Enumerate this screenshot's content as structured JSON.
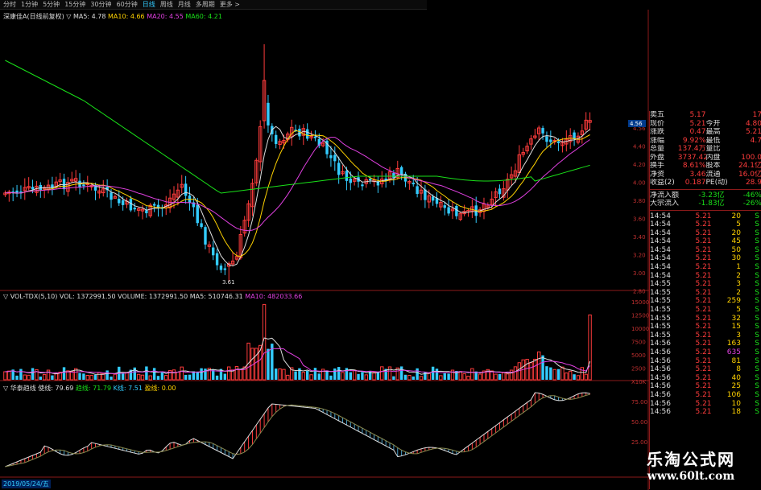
{
  "toolbar": {
    "items": [
      "分时",
      "1分钟",
      "5分钟",
      "15分钟",
      "30分钟",
      "60分钟",
      "日线",
      "周线",
      "月线",
      "多周期",
      "更多 >"
    ],
    "active_index": 6
  },
  "indicators": {
    "ma_line": {
      "name": "深康佳A(日线前复权)",
      "items": [
        {
          "label": "▽ MA5: 4.78",
          "color": "#dddddd"
        },
        {
          "label": "MA10: 4.66",
          "color": "#ffd200"
        },
        {
          "label": "MA20: 4.55",
          "color": "#e040e0"
        },
        {
          "label": "MA60: 4.21",
          "color": "#19e019"
        }
      ]
    },
    "vol_line": {
      "items": [
        {
          "label": "▽ VOL-TDX(5,10)  VOL: 1372991.50",
          "color": "#dddddd"
        },
        {
          "label": "VOLUME: 1372991.50",
          "color": "#dddddd"
        },
        {
          "label": "MA5: 510746.31",
          "color": "#dddddd"
        },
        {
          "label": "MA10: 482033.66",
          "color": "#e040e0"
        }
      ]
    },
    "ind_line": {
      "items": [
        {
          "label": "▽ 华泰趋线  使线: 79.69",
          "color": "#dddddd"
        },
        {
          "label": "趋线: 71.79",
          "color": "#19e019"
        },
        {
          "label": "K线: 7.51",
          "color": "#3cf"
        },
        {
          "label": "盈线: 0.00",
          "color": "#ffd200"
        }
      ]
    }
  },
  "price_axis": {
    "labels": [
      "4.56",
      "4.40",
      "4.20",
      "4.00",
      "3.80",
      "3.60",
      "3.40",
      "3.20",
      "3.00",
      "2.80"
    ],
    "tags": [
      {
        "text": "4.56",
        "color": "#3cf"
      }
    ]
  },
  "vol_axis": {
    "labels": [
      "15000",
      "12500",
      "10000",
      "7500",
      "5000",
      "2500",
      "X10K"
    ]
  },
  "ind_axis": {
    "labels": [
      "75.00",
      "50.00",
      "25.00"
    ]
  },
  "low_marker": "3.61",
  "quote": {
    "rows": [
      {
        "a": "卖五",
        "b": "5.17",
        "c": "",
        "d": "17"
      },
      {
        "a": "现价",
        "b": "5.21",
        "c": "今开",
        "d": "4.80"
      },
      {
        "a": "涨跌",
        "b": "0.47",
        "c": "最高",
        "d": "5.21"
      },
      {
        "a": "涨幅",
        "b": "9.92%",
        "c": "最低",
        "d": "4.7"
      },
      {
        "a": "总量",
        "b": "137.4万",
        "c": "量比",
        "d": ""
      },
      {
        "a": "外盘",
        "b": "3737.42",
        "c": "内盘",
        "d": "100.0"
      },
      {
        "a": "换手",
        "b": "8.61%",
        "c": "股本",
        "d": "24.1亿"
      },
      {
        "a": "净资",
        "b": "3.46",
        "c": "流通",
        "d": "16.0亿"
      },
      {
        "a": "收益(2)",
        "b": "0.187",
        "c": "PE(动)",
        "d": "28.9"
      }
    ],
    "flows": [
      {
        "a": "净流入额",
        "b": "-3.23亿",
        "c": "-46%"
      },
      {
        "a": "大宗流入",
        "b": "-1.83亿",
        "c": "-26%"
      }
    ]
  },
  "ticks": [
    {
      "t": "14:54",
      "p": "5.21",
      "v": "20",
      "s": "S"
    },
    {
      "t": "14:54",
      "p": "5.21",
      "v": "5",
      "s": "S"
    },
    {
      "t": "14:54",
      "p": "5.21",
      "v": "20",
      "s": "S"
    },
    {
      "t": "14:54",
      "p": "5.21",
      "v": "45",
      "s": "S"
    },
    {
      "t": "14:54",
      "p": "5.21",
      "v": "50",
      "s": "S"
    },
    {
      "t": "14:54",
      "p": "5.21",
      "v": "30",
      "s": "S"
    },
    {
      "t": "14:54",
      "p": "5.21",
      "v": "1",
      "s": "S"
    },
    {
      "t": "14:54",
      "p": "5.21",
      "v": "2",
      "s": "S"
    },
    {
      "t": "14:55",
      "p": "5.21",
      "v": "3",
      "s": "S"
    },
    {
      "t": "14:55",
      "p": "5.21",
      "v": "2",
      "s": "S"
    },
    {
      "t": "14:55",
      "p": "5.21",
      "v": "259",
      "s": "S"
    },
    {
      "t": "14:55",
      "p": "5.21",
      "v": "5",
      "s": "S"
    },
    {
      "t": "14:55",
      "p": "5.21",
      "v": "32",
      "s": "S"
    },
    {
      "t": "14:55",
      "p": "5.21",
      "v": "15",
      "s": "S"
    },
    {
      "t": "14:55",
      "p": "5.21",
      "v": "3",
      "s": "S"
    },
    {
      "t": "14:56",
      "p": "5.21",
      "v": "163",
      "s": "S"
    },
    {
      "t": "14:56",
      "p": "5.21",
      "v": "635",
      "s": "S"
    },
    {
      "t": "14:56",
      "p": "5.21",
      "v": "81",
      "s": "S"
    },
    {
      "t": "14:56",
      "p": "5.21",
      "v": "8",
      "s": "S"
    },
    {
      "t": "14:56",
      "p": "5.21",
      "v": "40",
      "s": "S"
    },
    {
      "t": "14:56",
      "p": "5.21",
      "v": "25",
      "s": "S"
    },
    {
      "t": "14:56",
      "p": "5.21",
      "v": "106",
      "s": "S"
    },
    {
      "t": "14:56",
      "p": "5.21",
      "v": "10",
      "s": "S"
    },
    {
      "t": "14:56",
      "p": "5.21",
      "v": "18",
      "s": "S"
    }
  ],
  "date_label": "2019/05/24/五",
  "watermark": {
    "title": "乐淘公式网",
    "url": "www.60lt.com"
  },
  "colors": {
    "up": "#ff3c3c",
    "down": "#3cf",
    "ma5": "#dddddd",
    "ma10": "#ffd200",
    "ma20": "#e040e0",
    "ma60": "#19e019",
    "grid": "#8b1a1a"
  }
}
